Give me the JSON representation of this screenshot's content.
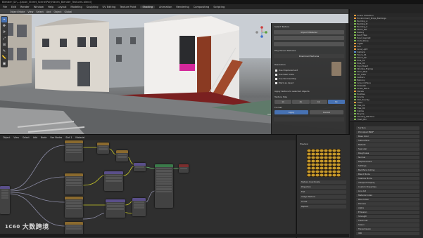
{
  "window": {
    "title": "Blender [D:\\...\\Japan_Street_Scene\\PolyHaven_Blender_Textures.blend]"
  },
  "menubar": {
    "items": [
      "File",
      "Edit",
      "Render",
      "Window",
      "Help",
      "Layout",
      "Modeling",
      "Sculpting",
      "UV Editing",
      "Texture Paint",
      "Shading",
      "Animation",
      "Rendering",
      "Compositing",
      "Scripting"
    ],
    "active": "Shading"
  },
  "viewport": {
    "header_items": [
      "Object Mode",
      "View",
      "Select",
      "Add",
      "Object",
      "Global"
    ],
    "tools": [
      "cursor-icon",
      "move-icon",
      "rotate-icon",
      "scale-icon",
      "transform-icon",
      "annotate-icon",
      "measure-icon",
      "add-cube-icon"
    ],
    "active_tool_index": 0
  },
  "npanel": {
    "tabs": [
      "Item",
      "Tool",
      "View",
      "BlenderKit",
      "Poly Haven"
    ],
    "section_top": "Select Texture",
    "btn_primary": "Import Material",
    "section_title": "Poly Haven Textures",
    "btn_download": "Download Textures",
    "group_label": "Resolution",
    "checkboxes": [
      {
        "label": "Use Displacement",
        "checked": true
      },
      {
        "label": "Use Real Scale",
        "checked": true
      },
      {
        "label": "Use Normal Map",
        "checked": true
      },
      {
        "label": "Mark as Asset",
        "checked": true
      }
    ],
    "subsection": "Apply texture to selected objects",
    "resolution_label": "Texture Size",
    "resolutions": [
      "1k",
      "2k",
      "4k",
      "8k"
    ],
    "selected_resolution": "8k",
    "format_label": "Format",
    "apply_button": "Apply",
    "cancel_button": "Cancel"
  },
  "outliner": {
    "rows": [
      {
        "name": "Scene Collection",
        "icon": "collection"
      },
      {
        "name": "Environment_Props_Buildings",
        "icon": "collection"
      },
      {
        "name": "Building_A",
        "icon": "mesh"
      },
      {
        "name": "Building_B",
        "icon": "mesh"
      },
      {
        "name": "Building_C",
        "icon": "mesh"
      },
      {
        "name": "Stairs_Ext",
        "icon": "mesh"
      },
      {
        "name": "Railing",
        "icon": "mesh"
      },
      {
        "name": "Roof_Tiles",
        "icon": "mesh"
      },
      {
        "name": "Road_Asphalt",
        "icon": "mesh"
      },
      {
        "name": "Curb_Stone",
        "icon": "mesh"
      },
      {
        "name": "Lights",
        "icon": "collection"
      },
      {
        "name": "Sun",
        "icon": "light"
      },
      {
        "name": "Area_Light",
        "icon": "light"
      },
      {
        "name": "Camera",
        "icon": "camera"
      },
      {
        "name": "Fence_01",
        "icon": "mesh"
      },
      {
        "name": "Fence_02",
        "icon": "mesh"
      },
      {
        "name": "Pole_01",
        "icon": "mesh"
      },
      {
        "name": "Pole_02",
        "icon": "mesh"
      },
      {
        "name": "Sign_Board",
        "icon": "mesh"
      },
      {
        "name": "Window_Frames",
        "icon": "mesh"
      },
      {
        "name": "Door_Main",
        "icon": "mesh"
      },
      {
        "name": "AC_Units",
        "icon": "mesh"
      },
      {
        "name": "Gutters",
        "icon": "mesh"
      },
      {
        "name": "Balcony",
        "icon": "mesh"
      },
      {
        "name": "Ground_Plane",
        "icon": "mesh"
      },
      {
        "name": "Sidewalk",
        "icon": "mesh"
      },
      {
        "name": "Grass_Patch",
        "icon": "mesh"
      },
      {
        "name": "Decals",
        "icon": "collection"
      },
      {
        "name": "Puddles",
        "icon": "mesh"
      },
      {
        "name": "Cracks",
        "icon": "mesh"
      },
      {
        "name": "Dirt_Overlay",
        "icon": "mesh"
      },
      {
        "name": "Trees",
        "icon": "collection"
      },
      {
        "name": "Tree_01",
        "icon": "mesh"
      },
      {
        "name": "Tree_02",
        "icon": "mesh"
      },
      {
        "name": "Cables",
        "icon": "mesh"
      },
      {
        "name": "Bicycle",
        "icon": "mesh"
      },
      {
        "name": "Vending_Machine",
        "icon": "mesh"
      },
      {
        "name": "Trash_Bin",
        "icon": "mesh"
      }
    ]
  },
  "properties": {
    "rows": [
      "Surface",
      "Principled BSDF",
      "Base Color",
      "Subsurface",
      "Metallic",
      "Specular",
      "Roughness",
      "Normal",
      "Displacement",
      "Settings",
      "Backface Culling",
      "Blend Mode",
      "Shadow Mode",
      "Viewport Display",
      "Custom Properties",
      "Line Art",
      "Material Index",
      "Pass Index",
      "Preview",
      "Alpha",
      "Emission",
      "Strength",
      "Clearcoat",
      "Sheen",
      "Transmission",
      "IOR"
    ]
  },
  "node_editor": {
    "header_items": [
      "Object",
      "View",
      "Select",
      "Add",
      "Node",
      "Use Nodes",
      "Slot 1",
      "Material"
    ]
  },
  "image_panel": {
    "title": "Preview",
    "rows": [
      "Texture Coordinate",
      "Projection",
      "Flat",
      "Image Texture",
      "Linear",
      "Repeat"
    ]
  },
  "watermark": {
    "logo": "1C60",
    "text": "大数跨境"
  },
  "colors": {
    "accent": "#4772b3",
    "shader_node_header": "#3b7a4a",
    "texture_node_header": "#8a6a2e",
    "vector_node_header": "#5a4f8a",
    "output_node_header": "#7a2e2e"
  }
}
